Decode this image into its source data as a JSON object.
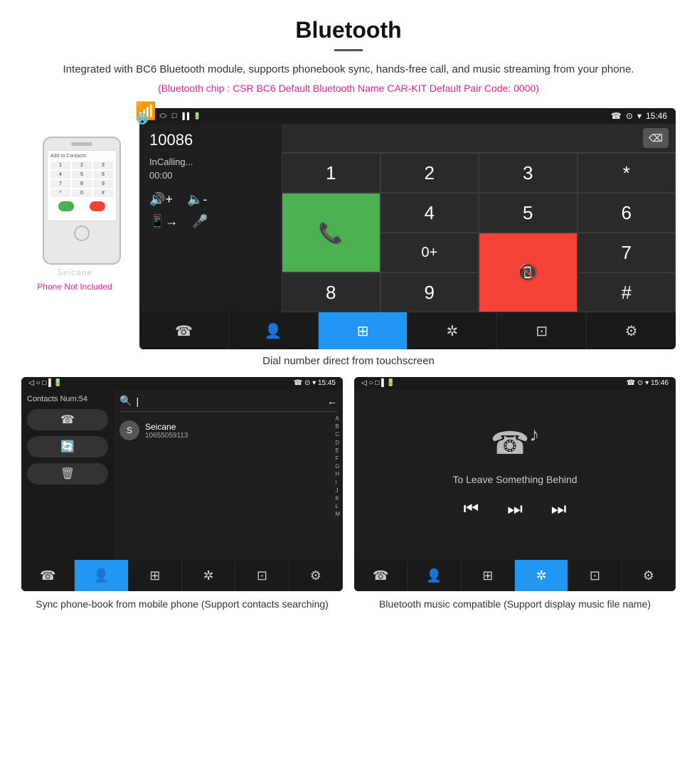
{
  "header": {
    "title": "Bluetooth",
    "description": "Integrated with BC6 Bluetooth module, supports phonebook sync, hands-free call, and music streaming from your phone.",
    "specs": "(Bluetooth chip : CSR BC6    Default Bluetooth Name CAR-KIT    Default Pair Code: 0000)"
  },
  "dial_screen": {
    "status_bar": {
      "left": [
        "◁",
        "○",
        "□"
      ],
      "right": [
        "☎",
        "⊙",
        "▾",
        "15:46"
      ]
    },
    "number": "10086",
    "status": "InCalling...",
    "timer": "00:00",
    "dialpad": [
      "1",
      "2",
      "3",
      "*",
      "4",
      "5",
      "6",
      "0+",
      "7",
      "8",
      "9",
      "#"
    ],
    "call_btn": "📞",
    "end_btn": "📵"
  },
  "phone_mockup": {
    "add_contacts": "Add to Contacts",
    "watermark": "Seicane",
    "not_included": "Phone Not Included"
  },
  "caption_main": "Dial number direct from touchscreen",
  "contacts_screen": {
    "status_bar_time": "15:45",
    "contacts_num": "Contacts Num:54",
    "contact_name": "Seicane",
    "contact_number": "10655059113"
  },
  "music_screen": {
    "status_bar_time": "15:46",
    "song_title": "To Leave Something Behind"
  },
  "caption_contacts": "Sync phone-book from mobile phone\n(Support contacts searching)",
  "caption_music": "Bluetooth music compatible\n(Support display music file name)",
  "nav_icons": {
    "phone": "☎",
    "contacts": "👤",
    "dialpad": "⊞",
    "bluetooth": "✲",
    "transfer": "⊡",
    "settings": "⚙"
  }
}
